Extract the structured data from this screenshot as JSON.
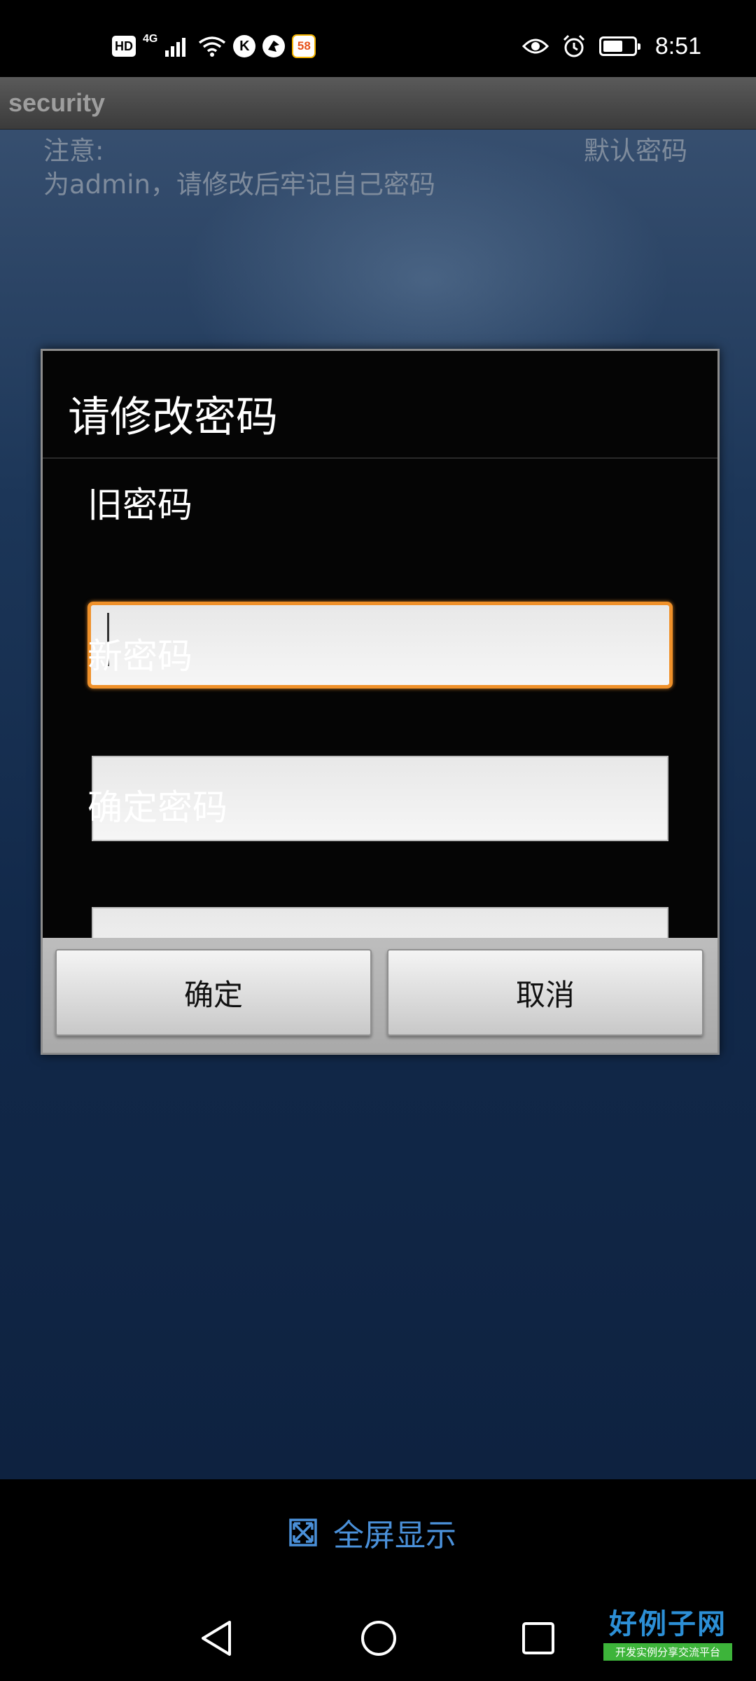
{
  "status_bar": {
    "hd_label": "HD",
    "network_label": "4G",
    "k_label": "K",
    "app58_label": "58",
    "time": "8:51",
    "battery_level": 0.65,
    "icons": [
      "hd-icon",
      "cell-signal-icon",
      "wifi-icon",
      "k-app-icon",
      "bird-app-icon",
      "app-58-icon",
      "eye-icon",
      "alarm-icon",
      "battery-icon"
    ]
  },
  "app": {
    "title": "security",
    "notice_label": "注意:",
    "notice_text": "为admin，请修改后牢记自己密码",
    "default_password_label": "默认密码"
  },
  "dialog": {
    "title": "请修改密码",
    "old_password_label": "旧密码",
    "old_password_value": "",
    "new_password_label": "新密码",
    "new_password_value": "",
    "confirm_password_label": "确定密码",
    "confirm_password_value": "",
    "ok_label": "确定",
    "cancel_label": "取消"
  },
  "fullscreen": {
    "label": "全屏显示"
  },
  "watermark": {
    "logo_text": "好例子网",
    "logo_subtext": "开发实例分享交流平台"
  },
  "colors": {
    "focus_border": "#f0912a",
    "fullscreen_text": "#4a90d9"
  }
}
